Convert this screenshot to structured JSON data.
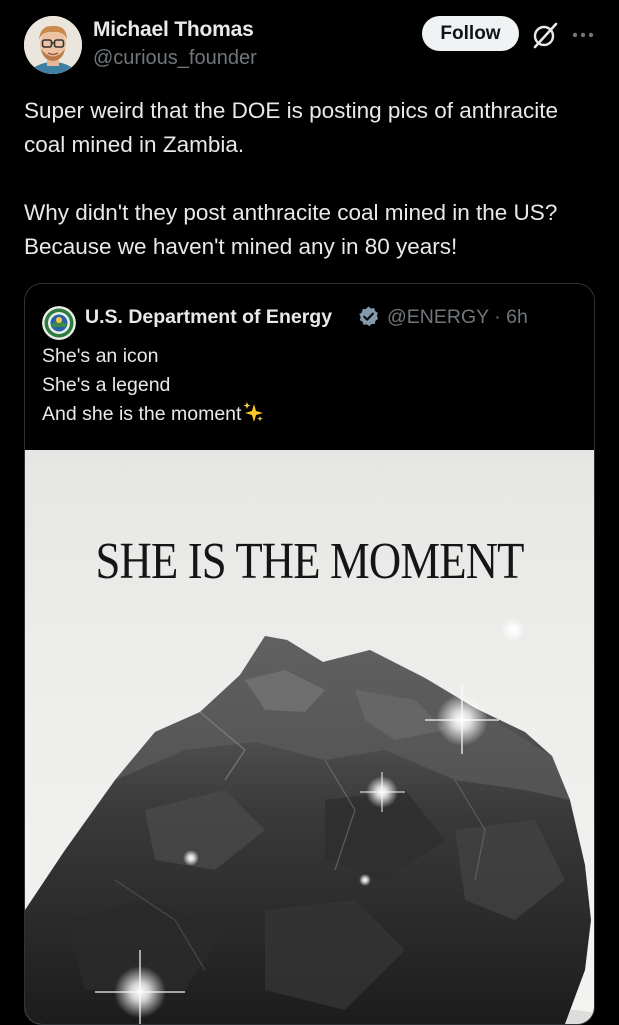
{
  "author": {
    "name": "Michael Thomas",
    "handle": "@curious_founder"
  },
  "follow_label": "Follow",
  "tweet": {
    "paragraphs": [
      "Super weird that the DOE is posting pics of anthracite coal mined in Zambia.",
      "Why didn't they post anthracite coal mined in the US? Because we haven't mined any in 80 years!"
    ]
  },
  "quote": {
    "name": "U.S. Department of Energy",
    "handle": "@ENERGY",
    "time": "6h",
    "handle_time": "@ENERGY · 6h",
    "lines": [
      "She's an icon",
      "She's a legend",
      "And she is the moment"
    ],
    "media_headline": "SHE IS THE MOMENT"
  },
  "icons": {
    "grok": "grok-icon",
    "more": "more-icon",
    "verified": "verified-badge-icon",
    "sparkles": "sparkles-emoji"
  },
  "colors": {
    "background": "#000000",
    "text_primary": "#e7e9ea",
    "text_secondary": "#71767b",
    "follow_bg": "#eff3f4",
    "verified": "#829aab",
    "border": "#2f3336"
  }
}
